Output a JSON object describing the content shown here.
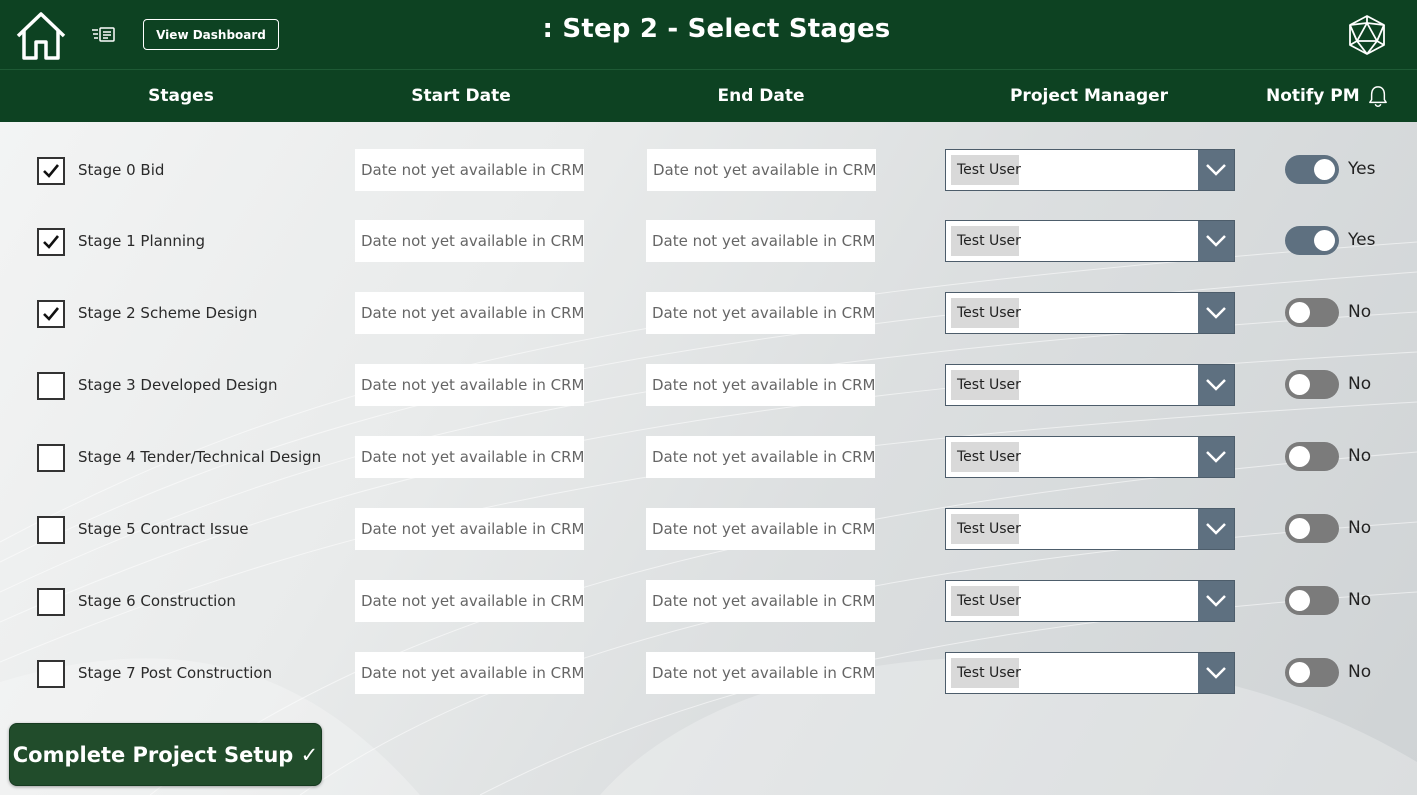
{
  "header": {
    "title": ": Step 2 - Select Stages",
    "view_dashboard_label": "View Dashboard"
  },
  "columns": {
    "stages": "Stages",
    "start_date": "Start Date",
    "end_date": "End Date",
    "project_manager": "Project Manager",
    "notify_pm": "Notify PM"
  },
  "stages": [
    {
      "label": "Stage 0 Bid",
      "checked": true,
      "start": "Date not yet available in CRM",
      "end": "Date not yet available in CRM",
      "pm": "Test User",
      "notify": true,
      "notify_label": "Yes"
    },
    {
      "label": "Stage 1 Planning",
      "checked": true,
      "start": "Date not yet available in CRM",
      "end": "Date not yet available in CRM",
      "pm": "Test User",
      "notify": true,
      "notify_label": "Yes"
    },
    {
      "label": "Stage 2 Scheme Design",
      "checked": true,
      "start": "Date not yet available in CRM",
      "end": "Date not yet available in CRM",
      "pm": "Test User",
      "notify": false,
      "notify_label": "No"
    },
    {
      "label": "Stage 3 Developed Design",
      "checked": false,
      "start": "Date not yet available in CRM",
      "end": "Date not yet available in CRM",
      "pm": "Test User",
      "notify": false,
      "notify_label": "No"
    },
    {
      "label": "Stage 4 Tender/Technical Design",
      "checked": false,
      "start": "Date not yet available in CRM",
      "end": "Date not yet available in CRM",
      "pm": "Test User",
      "notify": false,
      "notify_label": "No"
    },
    {
      "label": "Stage 5 Contract Issue",
      "checked": false,
      "start": "Date not yet available in CRM",
      "end": "Date not yet available in CRM",
      "pm": "Test User",
      "notify": false,
      "notify_label": "No"
    },
    {
      "label": "Stage 6 Construction",
      "checked": false,
      "start": "Date not yet available in CRM",
      "end": "Date not yet available in CRM",
      "pm": "Test User",
      "notify": false,
      "notify_label": "No"
    },
    {
      "label": "Stage 7 Post Construction",
      "checked": false,
      "start": "Date not yet available in CRM",
      "end": "Date not yet available in CRM",
      "pm": "Test User",
      "notify": false,
      "notify_label": "No"
    }
  ],
  "footer": {
    "complete_label": "Complete Project Setup ✓"
  },
  "icons": {
    "home": "home-icon",
    "menu": "menu-list-icon",
    "logo": "polyhedron-logo-icon",
    "bell": "bell-icon",
    "checkmark": "checkmark-icon",
    "chevron": "chevron-down-icon"
  },
  "colors": {
    "header_bg": "#0d4222",
    "button_bg": "#214c2b",
    "accent_slate": "#5e7080",
    "toggle_off": "#7b7b7b"
  }
}
